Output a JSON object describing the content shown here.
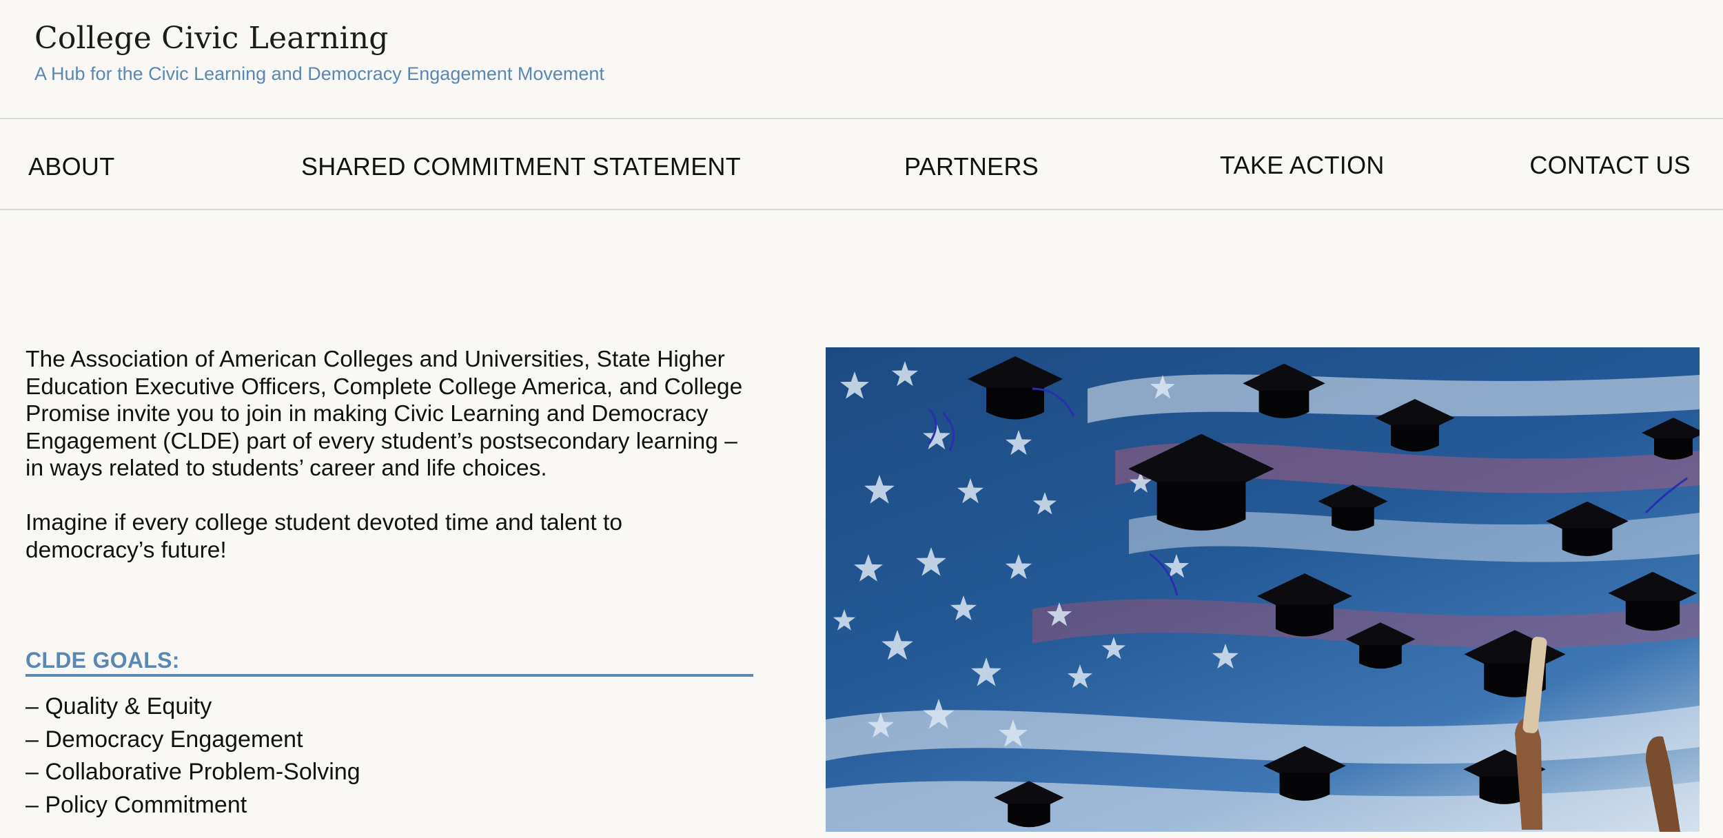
{
  "site": {
    "title": "College Civic Learning",
    "tagline": "A Hub for the Civic Learning and Democracy Engagement Movement"
  },
  "nav": {
    "items": [
      {
        "label": "ABOUT"
      },
      {
        "label": "SHARED COMMITMENT STATEMENT"
      },
      {
        "label": "PARTNERS"
      },
      {
        "label": "TAKE ACTION"
      },
      {
        "label": "CONTACT US"
      }
    ]
  },
  "intro": {
    "paragraph1": "The Association of American Colleges and Universities, State Higher Education Executive Officers, Complete College America, and College Promise invite you to join in making Civic Learning and Democracy Engagement (CLDE) part of every student’s postsecondary learning – in ways related to students’ career and life choices.",
    "paragraph2": "Imagine if every college student devoted time and talent to democracy’s future!"
  },
  "goals": {
    "heading": "CLDE GOALS:",
    "items": [
      "– Quality & Equity",
      "– Democracy Engagement",
      "– Collaborative Problem-Solving",
      "– Policy Commitment"
    ]
  },
  "colors": {
    "accent": "#5b87b4",
    "background": "#f9f8f5",
    "text": "#111111",
    "divider": "#d8d8d6"
  }
}
